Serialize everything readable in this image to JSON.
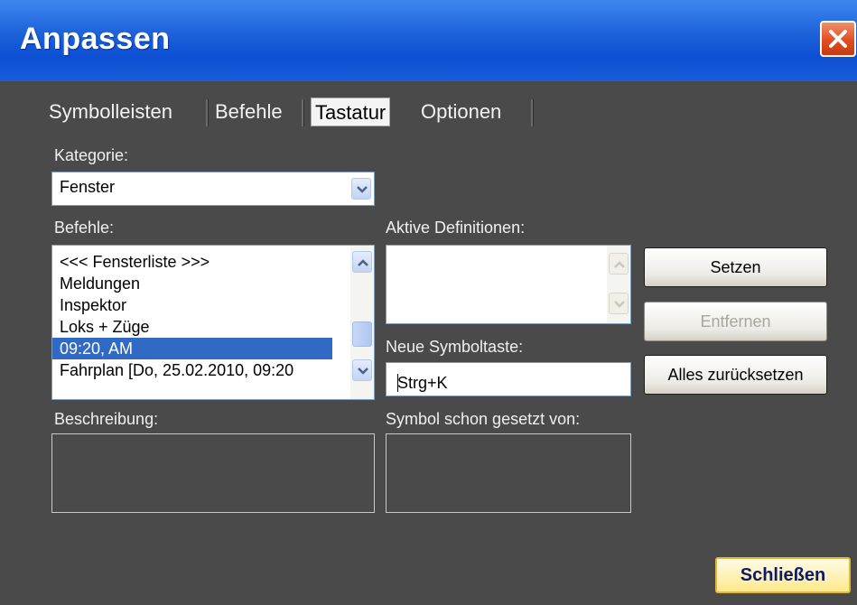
{
  "window": {
    "title": "Anpassen"
  },
  "tabs": [
    {
      "label": "Symbolleisten"
    },
    {
      "label": "Befehle"
    },
    {
      "label": "Tastatur"
    },
    {
      "label": "Optionen"
    }
  ],
  "active_tab": "Tastatur",
  "kategorie": {
    "label": "Kategorie:",
    "value": "Fenster"
  },
  "befehle": {
    "label": "Befehle:",
    "items": [
      "<<< Fensterliste >>>",
      "Meldungen",
      "Inspektor",
      "Loks + Züge",
      "09:20, AM",
      "Fahrplan [Do, 25.02.2010, 09:20"
    ],
    "selected": "09:20, AM"
  },
  "aktive_definitionen": {
    "label": "Aktive Definitionen:"
  },
  "neue_symboltaste": {
    "label": "Neue Symboltaste:",
    "value": "Strg+K"
  },
  "beschreibung": {
    "label": "Beschreibung:"
  },
  "symbol_gesetzt": {
    "label": "Symbol schon gesetzt von:"
  },
  "buttons": {
    "setzen": "Setzen",
    "entfernen": "Entfernen",
    "alles_zuruecksetzen": "Alles zurücksetzen",
    "schliessen": "Schließen"
  },
  "colors": {
    "titlebar": "#0c4fd3",
    "background": "#4a4a4a",
    "selection": "#316ac5",
    "close_accent": "#e24d22",
    "default_button": "#ffe98a"
  },
  "icons": [
    "close-icon",
    "chevron-down-icon",
    "chevron-up-icon"
  ]
}
